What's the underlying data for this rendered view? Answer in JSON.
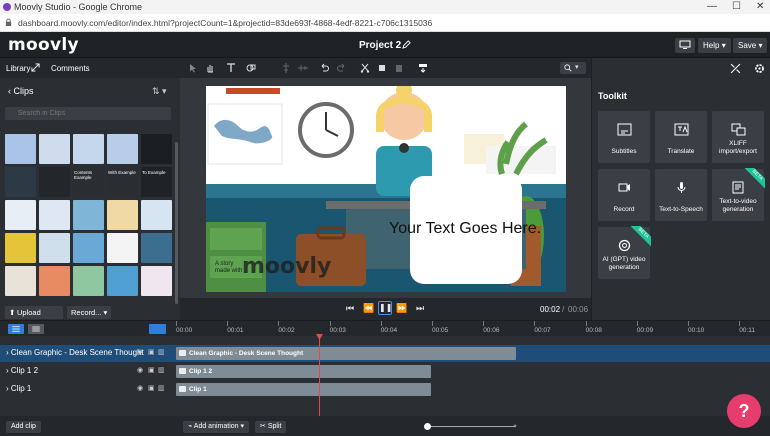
{
  "browser": {
    "title": "Moovly Studio - Google Chrome",
    "url": "dashboard.moovly.com/editor/index.html?projectCount=1&projectid=83de693f-4868-4edf-8221-c706c1315036"
  },
  "app": {
    "logo": "moovly",
    "project_title": "Project 2",
    "help_label": "Help",
    "help_caret": "▾",
    "save_label": "Save",
    "save_caret": "▾"
  },
  "left": {
    "tab_library": "Library",
    "tab_comments": "Comments",
    "clips_back": "‹",
    "clips_title": "Clips",
    "search_placeholder": "Search in Clips",
    "upload_label": "Upload media",
    "record_label": "Record...",
    "thumb_labels": [
      "Contents Example",
      "With Example",
      "To Example"
    ]
  },
  "canvas": {
    "text": "Your Text Goes Here.",
    "watermark_small": "A story made with",
    "watermark_logo": "moovly"
  },
  "player": {
    "current_time": "00:02",
    "separator": "/",
    "total_time": "00:06"
  },
  "toolkit": {
    "title": "Toolkit",
    "items": [
      {
        "label": "Subtitles",
        "icon": "subtitles-icon",
        "beta": false
      },
      {
        "label": "Translate",
        "icon": "translate-icon",
        "beta": false
      },
      {
        "label": "XLIFF import/export",
        "icon": "xliff-icon",
        "beta": false
      },
      {
        "label": "Record",
        "icon": "video-record-icon",
        "beta": false
      },
      {
        "label": "Text-to-Speech",
        "icon": "microphone-icon",
        "beta": false
      },
      {
        "label": "Text-to-video generation",
        "icon": "text-video-icon",
        "beta": true
      },
      {
        "label": "AI (GPT) video generation",
        "icon": "openai-icon",
        "beta": true
      }
    ],
    "beta_label": "BETA"
  },
  "timeline": {
    "ruler": [
      "00:00",
      "00:01",
      "00:02",
      "00:03",
      "00:04",
      "00:05",
      "00:06",
      "00:07",
      "00:08",
      "00:09",
      "00:10",
      "00:11"
    ],
    "rows": [
      {
        "label": "Clean Graphic - Desk Scene Thought",
        "track": "Clean Graphic - Desk Scene Thought"
      },
      {
        "label": "Clip 1 2",
        "track": "Clip 1 2"
      },
      {
        "label": "Clip 1",
        "track": "Clip 1"
      }
    ],
    "add_clip": "Add clip",
    "add_animation": "Add animation",
    "add_animation_caret": "▾",
    "split": "Split"
  },
  "help_fab": "?",
  "colors": {
    "accent": "#2f7fd6",
    "beta": "#1fc39a",
    "fab": "#e63d6c",
    "playhead": "#e34b4b"
  }
}
